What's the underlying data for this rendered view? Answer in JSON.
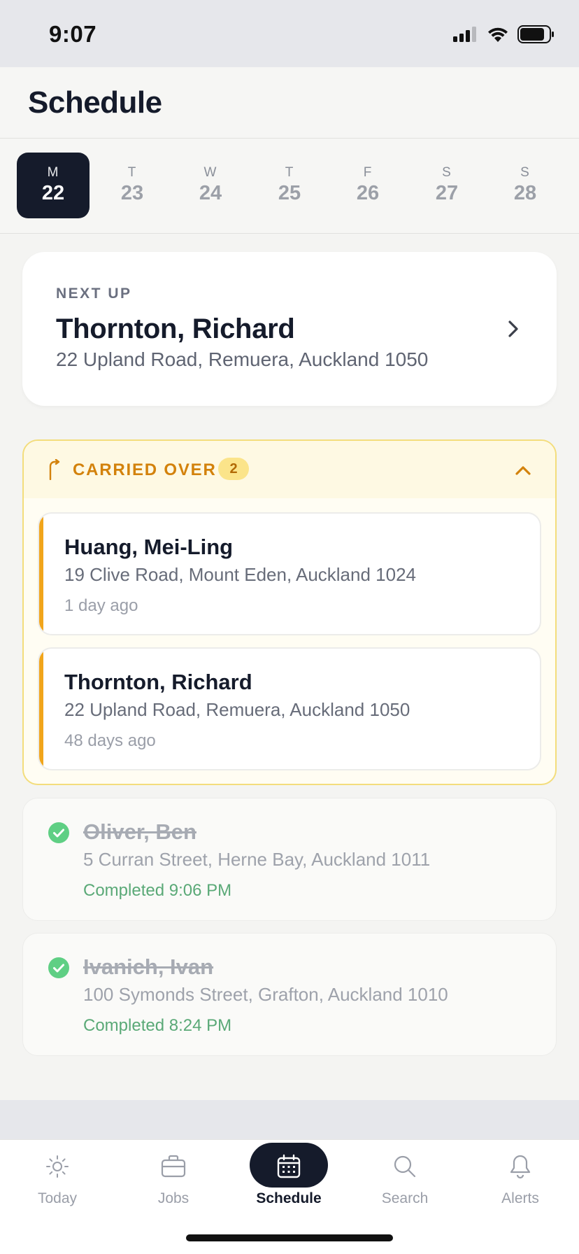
{
  "status_bar": {
    "time": "9:07"
  },
  "header": {
    "title": "Schedule"
  },
  "week": {
    "days": [
      {
        "letter": "M",
        "num": "22",
        "active": true
      },
      {
        "letter": "T",
        "num": "23"
      },
      {
        "letter": "W",
        "num": "24"
      },
      {
        "letter": "T",
        "num": "25"
      },
      {
        "letter": "F",
        "num": "26"
      },
      {
        "letter": "S",
        "num": "27"
      },
      {
        "letter": "S",
        "num": "28"
      }
    ]
  },
  "next_up": {
    "label": "NEXT UP",
    "name": "Thornton, Richard",
    "address": "22 Upland Road, Remuera, Auckland 1050"
  },
  "carried_over": {
    "title": "CARRIED OVER",
    "count": "2",
    "items": [
      {
        "name": "Huang, Mei-Ling",
        "address": "19 Clive Road, Mount Eden, Auckland 1024",
        "age": "1 day ago"
      },
      {
        "name": "Thornton, Richard",
        "address": "22 Upland Road, Remuera, Auckland 1050",
        "age": "48 days ago"
      }
    ]
  },
  "completed": [
    {
      "name": "Oliver, Ben",
      "address": "5 Curran Street, Herne Bay, Auckland 1011",
      "status": "Completed 9:06 PM"
    },
    {
      "name": "Ivanich, Ivan",
      "address": "100 Symonds Street, Grafton, Auckland 1010",
      "status": "Completed 8:24 PM"
    }
  ],
  "tabbar": {
    "tabs": [
      {
        "label": "Today",
        "icon": "sun-icon"
      },
      {
        "label": "Jobs",
        "icon": "briefcase-icon"
      },
      {
        "label": "Schedule",
        "icon": "calendar-icon",
        "active": true
      },
      {
        "label": "Search",
        "icon": "search-icon"
      },
      {
        "label": "Alerts",
        "icon": "bell-icon"
      }
    ]
  },
  "colors": {
    "primary_dark": "#151b2b",
    "carried_accent": "#f1a51b",
    "carried_text": "#d3820c",
    "completed_green": "#5aa977"
  }
}
